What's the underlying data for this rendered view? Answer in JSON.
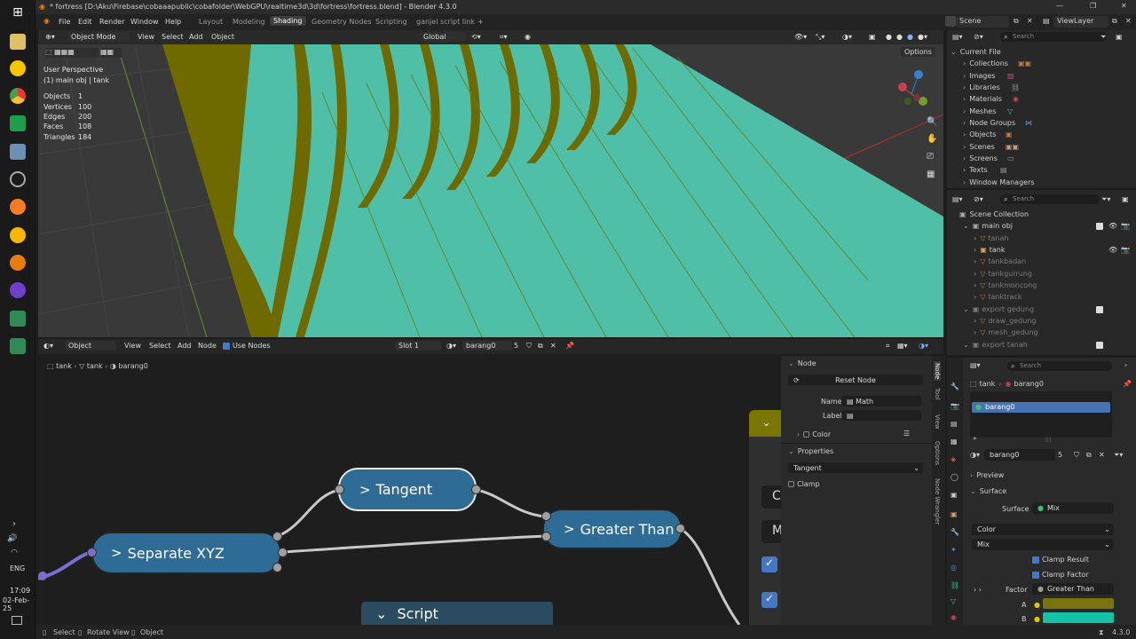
{
  "window": {
    "title": "* fortress [D:\\Aku\\Firebase\\cobaaapublic\\cobafolder\\WebGPU\\realtime3d\\3d\\fortress\\fortress.blend] - Blender 4.3.0"
  },
  "menu": [
    "File",
    "Edit",
    "Render",
    "Window",
    "Help"
  ],
  "workspaces": [
    "Layout",
    "Modeling",
    "Shading",
    "Geometry Nodes",
    "Scripting",
    "ganjel script link"
  ],
  "active_workspace": "Shading",
  "add_tab": "+",
  "scene_label": "Scene",
  "viewlayer_label": "ViewLayer",
  "viewport": {
    "mode": "Object Mode",
    "menus": [
      "View",
      "Select",
      "Add",
      "Object"
    ],
    "orientation": "Global",
    "options": "Options",
    "perspective": "User Perspective",
    "context": "(1) main obj | tank",
    "stats": [
      [
        "Objects",
        "1"
      ],
      [
        "Vertices",
        "100"
      ],
      [
        "Edges",
        "200"
      ],
      [
        "Faces",
        "108"
      ],
      [
        "Triangles",
        "184"
      ]
    ],
    "colors": {
      "olive": "#6f6a00",
      "teal": "#4fbfa8",
      "grid": "#3a3a3a"
    }
  },
  "nodeeditor": {
    "object": "Object",
    "menus": [
      "View",
      "Select",
      "Add",
      "Node"
    ],
    "use_nodes": "Use Nodes",
    "slot": "Slot 1",
    "material": "barang0",
    "users": "5",
    "breadcrumb": [
      "tank",
      "tank",
      "barang0"
    ],
    "nodes": {
      "tangent": "Tangent",
      "greater": "Greater Than",
      "separate": "Separate XYZ",
      "script": "Script"
    },
    "partial": {
      "c": "C",
      "m": "M"
    },
    "chevron": ">"
  },
  "npanel": {
    "section": "Node",
    "reset": "Reset Node",
    "name_label": "Name",
    "name_value": "Math",
    "label_label": "Label",
    "color": "Color",
    "properties": "Properties",
    "op": "Tangent",
    "clamp": "Clamp",
    "tabs": [
      "Node",
      "Tool",
      "View",
      "Options",
      "Node Wrangler"
    ]
  },
  "outliner_file": {
    "search": "Search",
    "root": "Current File",
    "items": [
      "Collections",
      "Images",
      "Libraries",
      "Materials",
      "Meshes",
      "Node Groups",
      "Objects",
      "Scenes",
      "Screens",
      "Texts",
      "Window Managers"
    ]
  },
  "outliner_scene": {
    "search": "Search",
    "root": "Scene Collection",
    "items": [
      {
        "label": "main obj",
        "dim": false
      },
      {
        "label": "tanah",
        "dim": true
      },
      {
        "label": "tank",
        "dim": false
      },
      {
        "label": "tankbadan",
        "dim": true
      },
      {
        "label": "tankgurrung",
        "dim": true
      },
      {
        "label": "tankmoncong",
        "dim": true
      },
      {
        "label": "tanktrack",
        "dim": true
      },
      {
        "label": "export gedung",
        "dim": true
      },
      {
        "label": "draw_gedung",
        "dim": true
      },
      {
        "label": "mesh_gedung",
        "dim": true
      },
      {
        "label": "export tanah",
        "dim": true
      }
    ]
  },
  "props": {
    "search": "Search",
    "crumb": [
      "tank",
      "barang0"
    ],
    "slot": "barang0",
    "material": "barang0",
    "users": "5",
    "preview": "Preview",
    "surface": "Surface",
    "surface_label": "Surface",
    "surface_value": "Mix",
    "color": "Color",
    "mix": "Mix",
    "clamp_result": "Clamp Result",
    "clamp_factor": "Clamp Factor",
    "factor_label": "Factor",
    "factor_value": "Greater Than",
    "a": "A",
    "b": "B",
    "colors": {
      "a": "#7a7410",
      "b": "#15c2a5"
    }
  },
  "taskbar": {
    "lang": "ENG",
    "time": "17:09",
    "date": "02-Feb-25"
  },
  "status": {
    "select": "Select",
    "rotate": "Rotate View",
    "object": "Object",
    "version": "4.3.0"
  }
}
